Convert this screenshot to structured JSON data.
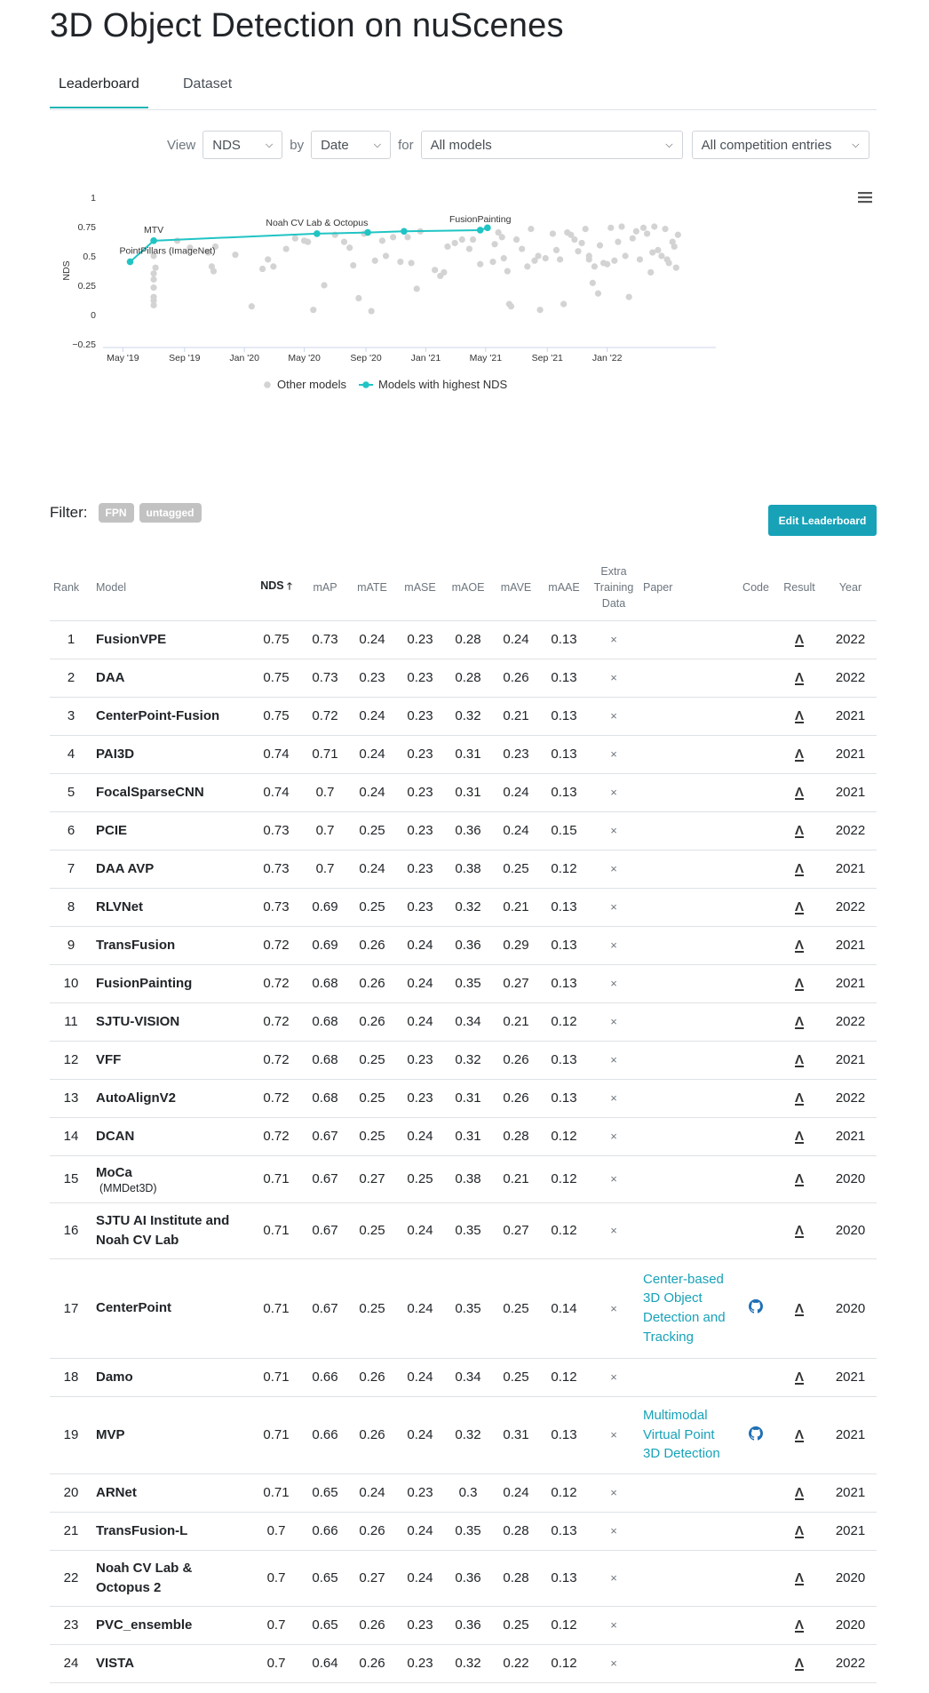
{
  "page_title": "3D Object Detection on nuScenes",
  "tabs": [
    {
      "label": "Leaderboard"
    },
    {
      "label": "Dataset"
    }
  ],
  "controls": {
    "view_label": "View",
    "view_value": "NDS",
    "by_label": "by",
    "by_value": "Date",
    "for_label": "for",
    "for_value": "All models",
    "entries_value": "All competition entries"
  },
  "chart_data": {
    "type": "scatter",
    "ylabel": "NDS",
    "ylim": [
      -0.25,
      1
    ],
    "yticks": [
      "1",
      "0.75",
      "0.5",
      "0.25",
      "0",
      "−0.25"
    ],
    "xticks": [
      "May '19",
      "Sep '19",
      "Jan '20",
      "May '20",
      "Sep '20",
      "Jan '21",
      "May '21",
      "Sep '21",
      "Jan '22"
    ],
    "legend": [
      "Other models",
      "Models with highest NDS"
    ],
    "legend_placement": "bottom",
    "highest_series": {
      "color": "#21c4c4",
      "points": [
        {
          "x": 2019.37,
          "y": 0.45,
          "label": "PointPillars (ImageNet)"
        },
        {
          "x": 2019.5,
          "y": 0.63,
          "label": "MTV"
        },
        {
          "x": 2020.4,
          "y": 0.69,
          "label": "Noah CV Lab & Octopus"
        },
        {
          "x": 2020.68,
          "y": 0.7,
          "label": ""
        },
        {
          "x": 2020.88,
          "y": 0.71,
          "label": ""
        },
        {
          "x": 2021.3,
          "y": 0.72,
          "label": "FusionPainting"
        },
        {
          "x": 2021.34,
          "y": 0.74,
          "label": ""
        }
      ]
    },
    "other_color": "#d3d3d3",
    "other_points": [
      [
        2019.5,
        0.35
      ],
      [
        2019.5,
        0.3
      ],
      [
        2019.5,
        0.23
      ],
      [
        2019.5,
        0.15
      ],
      [
        2019.5,
        0.12
      ],
      [
        2019.5,
        0.08
      ],
      [
        2019.5,
        0.5
      ],
      [
        2019.51,
        0.4
      ],
      [
        2019.63,
        0.63
      ],
      [
        2019.7,
        0.57
      ],
      [
        2019.8,
        0.53
      ],
      [
        2019.82,
        0.41
      ],
      [
        2019.83,
        0.37
      ],
      [
        2019.84,
        0.58
      ],
      [
        2019.95,
        0.51
      ],
      [
        2020.04,
        0.07
      ],
      [
        2020.1,
        0.39
      ],
      [
        2020.13,
        0.47
      ],
      [
        2020.16,
        0.41
      ],
      [
        2020.23,
        0.56
      ],
      [
        2020.28,
        0.65
      ],
      [
        2020.33,
        0.63
      ],
      [
        2020.35,
        0.62
      ],
      [
        2020.38,
        0.04
      ],
      [
        2020.44,
        0.25
      ],
      [
        2020.5,
        0.68
      ],
      [
        2020.55,
        0.62
      ],
      [
        2020.58,
        0.57
      ],
      [
        2020.6,
        0.42
      ],
      [
        2020.63,
        0.14
      ],
      [
        2020.66,
        0.69
      ],
      [
        2020.7,
        0.03
      ],
      [
        2020.72,
        0.46
      ],
      [
        2020.76,
        0.63
      ],
      [
        2020.78,
        0.5
      ],
      [
        2020.82,
        0.66
      ],
      [
        2020.86,
        0.45
      ],
      [
        2020.9,
        0.66
      ],
      [
        2020.92,
        0.44
      ],
      [
        2020.95,
        0.22
      ],
      [
        2020.97,
        0.71
      ],
      [
        2021.05,
        0.38
      ],
      [
        2021.08,
        0.33
      ],
      [
        2021.1,
        0.36
      ],
      [
        2021.12,
        0.58
      ],
      [
        2021.16,
        0.61
      ],
      [
        2021.2,
        0.64
      ],
      [
        2021.24,
        0.56
      ],
      [
        2021.26,
        0.64
      ],
      [
        2021.3,
        0.43
      ],
      [
        2021.37,
        0.45
      ],
      [
        2021.38,
        0.6
      ],
      [
        2021.4,
        0.7
      ],
      [
        2021.42,
        0.66
      ],
      [
        2021.43,
        0.48
      ],
      [
        2021.45,
        0.37
      ],
      [
        2021.46,
        0.09
      ],
      [
        2021.47,
        0.07
      ],
      [
        2021.5,
        0.64
      ],
      [
        2021.53,
        0.56
      ],
      [
        2021.56,
        0.41
      ],
      [
        2021.58,
        0.73
      ],
      [
        2021.6,
        0.46
      ],
      [
        2021.62,
        0.5
      ],
      [
        2021.63,
        0.04
      ],
      [
        2021.66,
        0.48
      ],
      [
        2021.7,
        0.69
      ],
      [
        2021.72,
        0.55
      ],
      [
        2021.74,
        0.47
      ],
      [
        2021.78,
        0.7
      ],
      [
        2021.8,
        0.68
      ],
      [
        2021.82,
        0.64
      ],
      [
        2021.84,
        0.54
      ],
      [
        2021.86,
        0.61
      ],
      [
        2021.88,
        0.73
      ],
      [
        2021.9,
        0.47
      ],
      [
        2021.92,
        0.27
      ],
      [
        2021.93,
        0.41
      ],
      [
        2021.95,
        0.18
      ],
      [
        2021.96,
        0.59
      ],
      [
        2021.98,
        0.44
      ],
      [
        2022.0,
        0.43
      ],
      [
        2022.02,
        0.74
      ],
      [
        2022.04,
        0.46
      ],
      [
        2022.06,
        0.62
      ],
      [
        2022.08,
        0.75
      ],
      [
        2022.1,
        0.5
      ],
      [
        2022.12,
        0.15
      ],
      [
        2022.14,
        0.65
      ],
      [
        2022.16,
        0.71
      ],
      [
        2022.18,
        0.47
      ],
      [
        2022.2,
        0.74
      ],
      [
        2022.22,
        0.69
      ],
      [
        2022.24,
        0.36
      ],
      [
        2022.26,
        0.75
      ],
      [
        2022.28,
        0.55
      ],
      [
        2022.3,
        0.5
      ],
      [
        2022.32,
        0.73
      ],
      [
        2022.34,
        0.44
      ],
      [
        2022.36,
        0.62
      ],
      [
        2022.37,
        0.58
      ],
      [
        2022.38,
        0.4
      ],
      [
        2022.39,
        0.68
      ],
      [
        2021.76,
        0.09
      ],
      [
        2021.9,
        0.5
      ],
      [
        2022.25,
        0.53
      ],
      [
        2022.33,
        0.47
      ]
    ]
  },
  "filter": {
    "label": "Filter:",
    "tags": [
      "FPN",
      "untagged"
    ]
  },
  "edit_button_label": "Edit Leaderboard",
  "table": {
    "headers": [
      "Rank",
      "Model",
      "NDS",
      "mAP",
      "mATE",
      "mASE",
      "mAOE",
      "mAVE",
      "mAAE",
      "Extra Training Data",
      "Paper",
      "Code",
      "Result",
      "Year"
    ],
    "sort_arrow": "🡑",
    "x_mark": "×",
    "result_icon": "Λ",
    "rows": [
      {
        "rank": "1",
        "model": "FusionVPE",
        "sub": "",
        "nds": "0.75",
        "map": "0.73",
        "mate": "0.24",
        "mase": "0.23",
        "maoe": "0.28",
        "mave": "0.24",
        "maae": "0.13",
        "paper": "",
        "code": false,
        "year": "2022"
      },
      {
        "rank": "2",
        "model": "DAA",
        "sub": "",
        "nds": "0.75",
        "map": "0.73",
        "mate": "0.23",
        "mase": "0.23",
        "maoe": "0.28",
        "mave": "0.26",
        "maae": "0.13",
        "paper": "",
        "code": false,
        "year": "2022"
      },
      {
        "rank": "3",
        "model": "CenterPoint-Fusion",
        "sub": "",
        "nds": "0.75",
        "map": "0.72",
        "mate": "0.24",
        "mase": "0.23",
        "maoe": "0.32",
        "mave": "0.21",
        "maae": "0.13",
        "paper": "",
        "code": false,
        "year": "2021"
      },
      {
        "rank": "4",
        "model": "PAI3D",
        "sub": "",
        "nds": "0.74",
        "map": "0.71",
        "mate": "0.24",
        "mase": "0.23",
        "maoe": "0.31",
        "mave": "0.23",
        "maae": "0.13",
        "paper": "",
        "code": false,
        "year": "2021"
      },
      {
        "rank": "5",
        "model": "FocalSparseCNN",
        "sub": "",
        "nds": "0.74",
        "map": "0.7",
        "mate": "0.24",
        "mase": "0.23",
        "maoe": "0.31",
        "mave": "0.24",
        "maae": "0.13",
        "paper": "",
        "code": false,
        "year": "2021"
      },
      {
        "rank": "6",
        "model": "PCIE",
        "sub": "",
        "nds": "0.73",
        "map": "0.7",
        "mate": "0.25",
        "mase": "0.23",
        "maoe": "0.36",
        "mave": "0.24",
        "maae": "0.15",
        "paper": "",
        "code": false,
        "year": "2022"
      },
      {
        "rank": "7",
        "model": "DAA AVP",
        "sub": "",
        "nds": "0.73",
        "map": "0.7",
        "mate": "0.24",
        "mase": "0.23",
        "maoe": "0.38",
        "mave": "0.25",
        "maae": "0.12",
        "paper": "",
        "code": false,
        "year": "2021"
      },
      {
        "rank": "8",
        "model": "RLVNet",
        "sub": "",
        "nds": "0.73",
        "map": "0.69",
        "mate": "0.25",
        "mase": "0.23",
        "maoe": "0.32",
        "mave": "0.21",
        "maae": "0.13",
        "paper": "",
        "code": false,
        "year": "2022"
      },
      {
        "rank": "9",
        "model": "TransFusion",
        "sub": "",
        "nds": "0.72",
        "map": "0.69",
        "mate": "0.26",
        "mase": "0.24",
        "maoe": "0.36",
        "mave": "0.29",
        "maae": "0.13",
        "paper": "",
        "code": false,
        "year": "2021"
      },
      {
        "rank": "10",
        "model": "FusionPainting",
        "sub": "",
        "nds": "0.72",
        "map": "0.68",
        "mate": "0.26",
        "mase": "0.24",
        "maoe": "0.35",
        "mave": "0.27",
        "maae": "0.13",
        "paper": "",
        "code": false,
        "year": "2021"
      },
      {
        "rank": "11",
        "model": "SJTU-VISION",
        "sub": "",
        "nds": "0.72",
        "map": "0.68",
        "mate": "0.26",
        "mase": "0.24",
        "maoe": "0.34",
        "mave": "0.21",
        "maae": "0.12",
        "paper": "",
        "code": false,
        "year": "2022"
      },
      {
        "rank": "12",
        "model": "VFF",
        "sub": "",
        "nds": "0.72",
        "map": "0.68",
        "mate": "0.25",
        "mase": "0.23",
        "maoe": "0.32",
        "mave": "0.26",
        "maae": "0.13",
        "paper": "",
        "code": false,
        "year": "2021"
      },
      {
        "rank": "13",
        "model": "AutoAlignV2",
        "sub": "",
        "nds": "0.72",
        "map": "0.68",
        "mate": "0.25",
        "mase": "0.23",
        "maoe": "0.31",
        "mave": "0.26",
        "maae": "0.13",
        "paper": "",
        "code": false,
        "year": "2022"
      },
      {
        "rank": "14",
        "model": "DCAN",
        "sub": "",
        "nds": "0.72",
        "map": "0.67",
        "mate": "0.25",
        "mase": "0.24",
        "maoe": "0.31",
        "mave": "0.28",
        "maae": "0.12",
        "paper": "",
        "code": false,
        "year": "2021"
      },
      {
        "rank": "15",
        "model": "MoCa",
        "sub": "(MMDet3D)",
        "nds": "0.71",
        "map": "0.67",
        "mate": "0.27",
        "mase": "0.25",
        "maoe": "0.38",
        "mave": "0.21",
        "maae": "0.12",
        "paper": "",
        "code": false,
        "year": "2020"
      },
      {
        "rank": "16",
        "model": "SJTU AI Institute and Noah CV Lab",
        "sub": "",
        "nds": "0.71",
        "map": "0.67",
        "mate": "0.25",
        "mase": "0.24",
        "maoe": "0.35",
        "mave": "0.27",
        "maae": "0.12",
        "paper": "",
        "code": false,
        "year": "2020"
      },
      {
        "rank": "17",
        "model": "CenterPoint",
        "sub": "",
        "nds": "0.71",
        "map": "0.67",
        "mate": "0.25",
        "mase": "0.24",
        "maoe": "0.35",
        "mave": "0.25",
        "maae": "0.14",
        "paper": "Center-based 3D Object Detection and Tracking",
        "code": true,
        "year": "2020"
      },
      {
        "rank": "18",
        "model": "Damo",
        "sub": "",
        "nds": "0.71",
        "map": "0.66",
        "mate": "0.26",
        "mase": "0.24",
        "maoe": "0.34",
        "mave": "0.25",
        "maae": "0.12",
        "paper": "",
        "code": false,
        "year": "2021"
      },
      {
        "rank": "19",
        "model": "MVP",
        "sub": "",
        "nds": "0.71",
        "map": "0.66",
        "mate": "0.26",
        "mase": "0.24",
        "maoe": "0.32",
        "mave": "0.31",
        "maae": "0.13",
        "paper": "Multimodal Virtual Point 3D Detection",
        "code": true,
        "year": "2021"
      },
      {
        "rank": "20",
        "model": "ARNet",
        "sub": "",
        "nds": "0.71",
        "map": "0.65",
        "mate": "0.24",
        "mase": "0.23",
        "maoe": "0.3",
        "mave": "0.24",
        "maae": "0.12",
        "paper": "",
        "code": false,
        "year": "2021"
      },
      {
        "rank": "21",
        "model": "TransFusion-L",
        "sub": "",
        "nds": "0.7",
        "map": "0.66",
        "mate": "0.26",
        "mase": "0.24",
        "maoe": "0.35",
        "mave": "0.28",
        "maae": "0.13",
        "paper": "",
        "code": false,
        "year": "2021"
      },
      {
        "rank": "22",
        "model": "Noah CV Lab & Octopus 2",
        "sub": "",
        "nds": "0.7",
        "map": "0.65",
        "mate": "0.27",
        "mase": "0.24",
        "maoe": "0.36",
        "mave": "0.28",
        "maae": "0.13",
        "paper": "",
        "code": false,
        "year": "2020"
      },
      {
        "rank": "23",
        "model": "PVC_ensemble",
        "sub": "",
        "nds": "0.7",
        "map": "0.65",
        "mate": "0.26",
        "mase": "0.23",
        "maoe": "0.36",
        "mave": "0.25",
        "maae": "0.12",
        "paper": "",
        "code": false,
        "year": "2020"
      },
      {
        "rank": "24",
        "model": "VISTA",
        "sub": "",
        "nds": "0.7",
        "map": "0.64",
        "mate": "0.26",
        "mase": "0.23",
        "maoe": "0.32",
        "mave": "0.22",
        "maae": "0.12",
        "paper": "",
        "code": false,
        "year": "2022"
      }
    ]
  }
}
